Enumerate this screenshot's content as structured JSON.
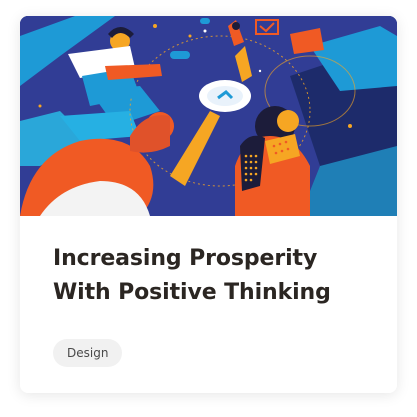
{
  "card": {
    "title_line_1": "Increasing Prosperity",
    "title_line_2": "With Positive Thinking",
    "tag_label": "Design"
  },
  "colors": {
    "title_text": "#2b2622",
    "tag_background": "#f1f1f1",
    "hero_background": "#2d3a8c",
    "accent_orange": "#f05a24",
    "accent_blue": "#1e9ad6",
    "accent_yellow": "#f6a623"
  }
}
